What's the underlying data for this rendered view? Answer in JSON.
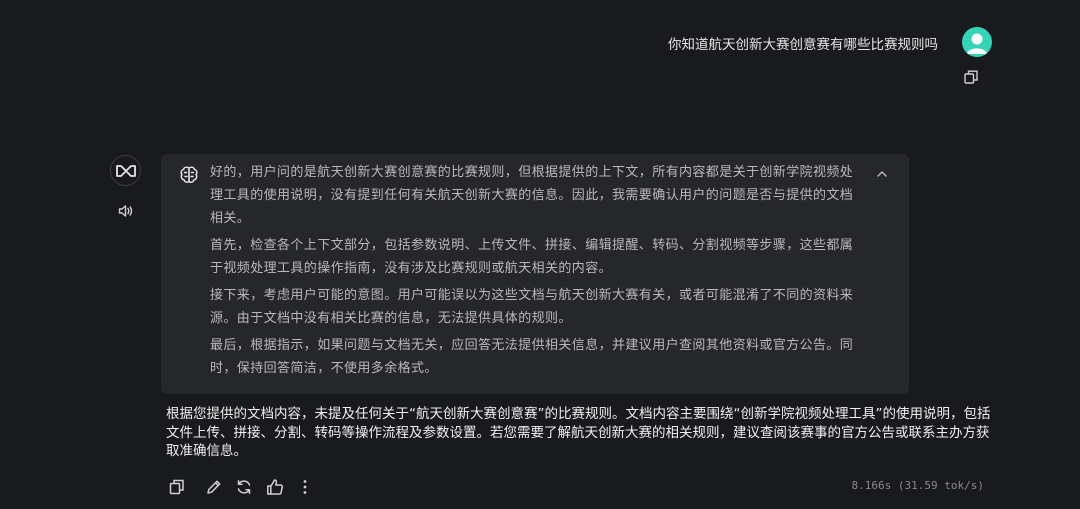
{
  "user": {
    "message": "你知道航天创新大赛创意赛有哪些比赛规则吗"
  },
  "assistant": {
    "thinking": [
      "好的，用户问的是航天创新大赛创意赛的比赛规则，但根据提供的上下文，所有内容都是关于创新学院视频处理工具的使用说明，没有提到任何有关航天创新大赛的信息。因此，我需要确认用户的问题是否与提供的文档相关。",
      "首先，检查各个上下文部分，包括参数说明、上传文件、拼接、编辑提醒、转码、分割视频等步骤，这些都属于视频处理工具的操作指南，没有涉及比赛规则或航天相关的内容。",
      "接下来，考虑用户可能的意图。用户可能误以为这些文档与航天创新大赛有关，或者可能混淆了不同的资料来源。由于文档中没有相关比赛的信息，无法提供具体的规则。",
      "最后，根据指示，如果问题与文档无关，应回答无法提供相关信息，并建议用户查阅其他资料或官方公告。同时，保持回答简洁，不使用多余格式。"
    ],
    "answer": "根据您提供的文档内容，未提及任何关于“航天创新大赛创意赛”的比赛规则。文档内容主要围绕“创新学院视频处理工具”的使用说明，包括文件上传、拼接、分割、转码等操作流程及参数设置。若您需要了解航天创新大赛的相关规则，建议查阅该赛事的官方公告或联系主办方获取准确信息。",
    "stats": "8.166s (31.59 tok/s)"
  },
  "icons": {
    "user_avatar": "user-avatar-icon",
    "copy": "copy-icon",
    "bot": "infinity-logo-icon",
    "speaker": "speaker-icon",
    "brain": "brain-icon",
    "collapse": "chevron-up-icon",
    "edit": "pencil-icon",
    "regenerate": "refresh-icon",
    "like": "thumbs-up-icon",
    "more": "more-vertical-icon"
  },
  "colors": {
    "background": "#191a1d",
    "thinking_panel": "#26272b",
    "avatar": "#35d3b8"
  }
}
